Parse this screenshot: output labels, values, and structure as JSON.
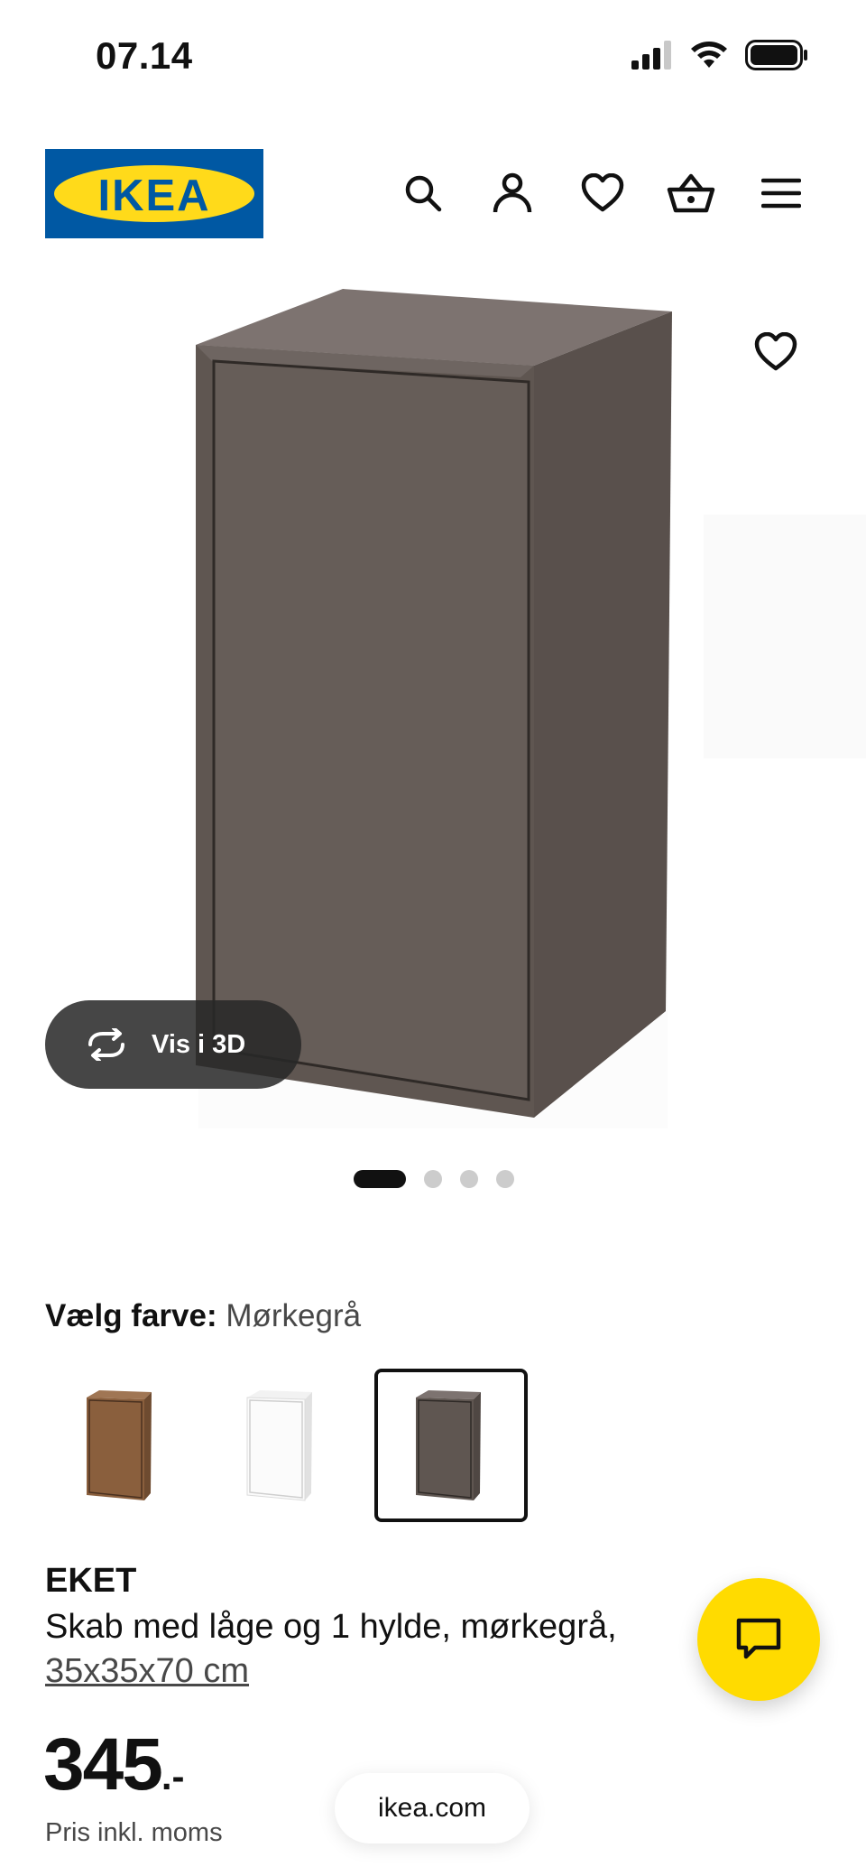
{
  "status_bar": {
    "time": "07.14"
  },
  "header": {
    "logo_text": "IKEA",
    "icons": [
      "search-icon",
      "user-icon",
      "heart-icon",
      "basket-icon",
      "menu-icon"
    ]
  },
  "gallery": {
    "view_3d_label": "Vis i 3D",
    "image_count": 4,
    "active_index": 0
  },
  "color": {
    "label": "Vælg farve:",
    "selected": "Mørkegrå",
    "options": [
      "walnut-brown",
      "white",
      "dark-grey"
    ],
    "selected_index": 2
  },
  "product": {
    "name": "EKET",
    "description": "Skab med låge og 1 hylde, mørkegrå,",
    "size": "35x35x70 cm",
    "price": "345",
    "price_suffix": ".-",
    "price_note": "Pris inkl. moms"
  },
  "browser": {
    "url": "ikea.com"
  },
  "colors": {
    "ikea_blue": "#0058A3",
    "ikea_yellow": "#FFDA1A",
    "cabinet_dark_grey": "#5F5651",
    "chat_yellow": "#FFDB00"
  }
}
